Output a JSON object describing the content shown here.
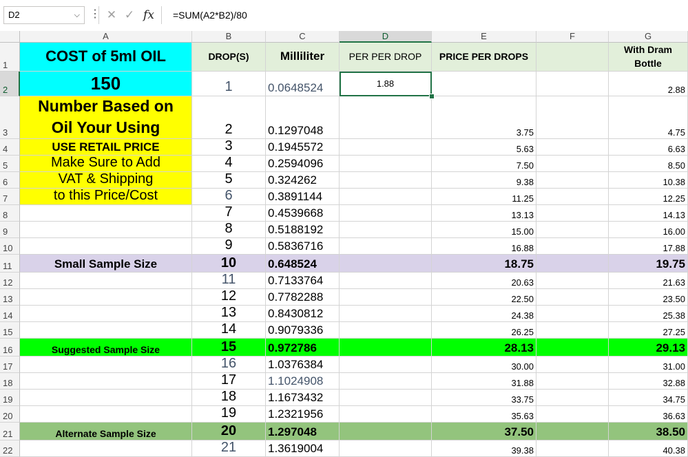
{
  "formula_bar": {
    "name_box": "D2",
    "formula": "=SUM(A2*B2)/80",
    "cancel_icon": "✕",
    "enter_icon": "✓",
    "fx_label": "fx"
  },
  "columns": [
    "A",
    "B",
    "C",
    "D",
    "E",
    "F",
    "G"
  ],
  "rows": [
    "1",
    "2",
    "3",
    "4",
    "5",
    "6",
    "7",
    "8",
    "9",
    "10",
    "11",
    "12",
    "13",
    "14",
    "15",
    "16",
    "17",
    "18",
    "19",
    "20",
    "21",
    "22"
  ],
  "colors": {
    "cyan": "#00ffff",
    "yellow": "#ffff00",
    "header_green": "#e2efda",
    "lavender": "#d9d2e9",
    "bright_green": "#00ff00",
    "sage_green": "#93c47d",
    "selection": "#217346"
  },
  "header": {
    "a1": "COST of 5ml OIL",
    "b1": "DROP(S)",
    "c1": "Milliliter",
    "d1": "PER PER DROP",
    "e1": "PRICE PER DROPS",
    "f1": "",
    "g1_line1": "With Dram",
    "g1_line2": "Bottle"
  },
  "a_notes": {
    "a2": "150",
    "a3_line1": "Number Based on",
    "a3_line2": "Oil Your Using",
    "a4": "USE RETAIL PRICE",
    "a5": "Make Sure to Add",
    "a6": "VAT & Shipping",
    "a7": "to this Price/Cost",
    "a11": "Small Sample Size",
    "a16": "Suggested Sample Size",
    "a21": "Alternate Sample Size"
  },
  "d2": "1.88",
  "table": [
    {
      "b": "1",
      "c": "0.0648524",
      "e": "",
      "g": "2.88"
    },
    {
      "b": "2",
      "c": "0.1297048",
      "e": "3.75",
      "g": "4.75"
    },
    {
      "b": "3",
      "c": "0.1945572",
      "e": "5.63",
      "g": "6.63"
    },
    {
      "b": "4",
      "c": "0.2594096",
      "e": "7.50",
      "g": "8.50"
    },
    {
      "b": "5",
      "c": "0.324262",
      "e": "9.38",
      "g": "10.38"
    },
    {
      "b": "6",
      "c": "0.3891144",
      "e": "11.25",
      "g": "12.25"
    },
    {
      "b": "7",
      "c": "0.4539668",
      "e": "13.13",
      "g": "14.13"
    },
    {
      "b": "8",
      "c": "0.5188192",
      "e": "15.00",
      "g": "16.00"
    },
    {
      "b": "9",
      "c": "0.5836716",
      "e": "16.88",
      "g": "17.88"
    },
    {
      "b": "10",
      "c": "0.648524",
      "e": "18.75",
      "g": "19.75"
    },
    {
      "b": "11",
      "c": "0.7133764",
      "e": "20.63",
      "g": "21.63"
    },
    {
      "b": "12",
      "c": "0.7782288",
      "e": "22.50",
      "g": "23.50"
    },
    {
      "b": "13",
      "c": "0.8430812",
      "e": "24.38",
      "g": "25.38"
    },
    {
      "b": "14",
      "c": "0.9079336",
      "e": "26.25",
      "g": "27.25"
    },
    {
      "b": "15",
      "c": "0.972786",
      "e": "28.13",
      "g": "29.13"
    },
    {
      "b": "16",
      "c": "1.0376384",
      "e": "30.00",
      "g": "31.00"
    },
    {
      "b": "17",
      "c": "1.1024908",
      "e": "31.88",
      "g": "32.88"
    },
    {
      "b": "18",
      "c": "1.1673432",
      "e": "33.75",
      "g": "34.75"
    },
    {
      "b": "19",
      "c": "1.2321956",
      "e": "35.63",
      "g": "36.63"
    },
    {
      "b": "20",
      "c": "1.297048",
      "e": "37.50",
      "g": "38.50"
    },
    {
      "b": "21",
      "c": "1.3619004",
      "e": "39.38",
      "g": "40.38"
    }
  ]
}
